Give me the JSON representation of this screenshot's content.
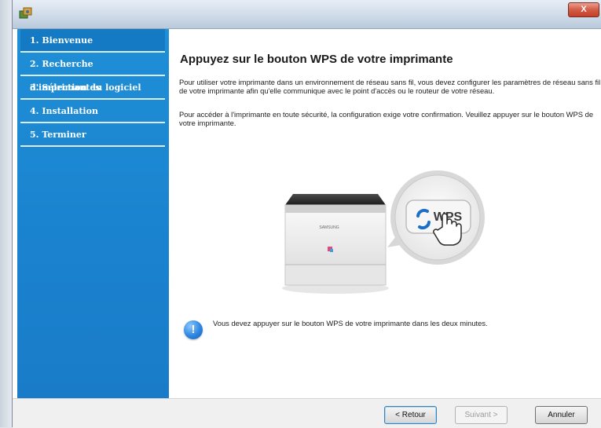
{
  "window": {
    "title": "",
    "close_label": "X"
  },
  "sidebar": {
    "steps": [
      {
        "label": "1. Bienvenue",
        "active": true
      },
      {
        "label": "2. Recherche d'imprimantes",
        "active": false
      },
      {
        "label": "3. Sélection du logiciel",
        "active": false
      },
      {
        "label": "4. Installation",
        "active": false
      },
      {
        "label": "5. Terminer",
        "active": false
      }
    ]
  },
  "main": {
    "heading": "Appuyez sur le bouton WPS  de votre imprimante",
    "paragraph1": "Pour utiliser votre imprimante dans un environnement de réseau sans fil, vous devez configurer les paramètres de réseau sans fil de votre imprimante afin qu'elle communique avec le point d'accès ou le routeur de votre réseau.",
    "paragraph2": "Pour accéder à l'imprimante en toute sécurité, la configuration exige votre confirmation.  Veuillez appuyer sur le bouton WPS  de votre imprimante.",
    "illustration": {
      "printer_brand": "SAMSUNG",
      "wps_button_label": "WPS"
    },
    "note": "Vous devez appuyer sur le bouton WPS  de votre imprimante dans les deux minutes."
  },
  "footer": {
    "back_label": "< Retour",
    "next_label": "Suivant >",
    "cancel_label": "Annuler"
  },
  "colors": {
    "sidebar_blue": "#1a82cf",
    "wps_blue": "#1b6fc9"
  }
}
